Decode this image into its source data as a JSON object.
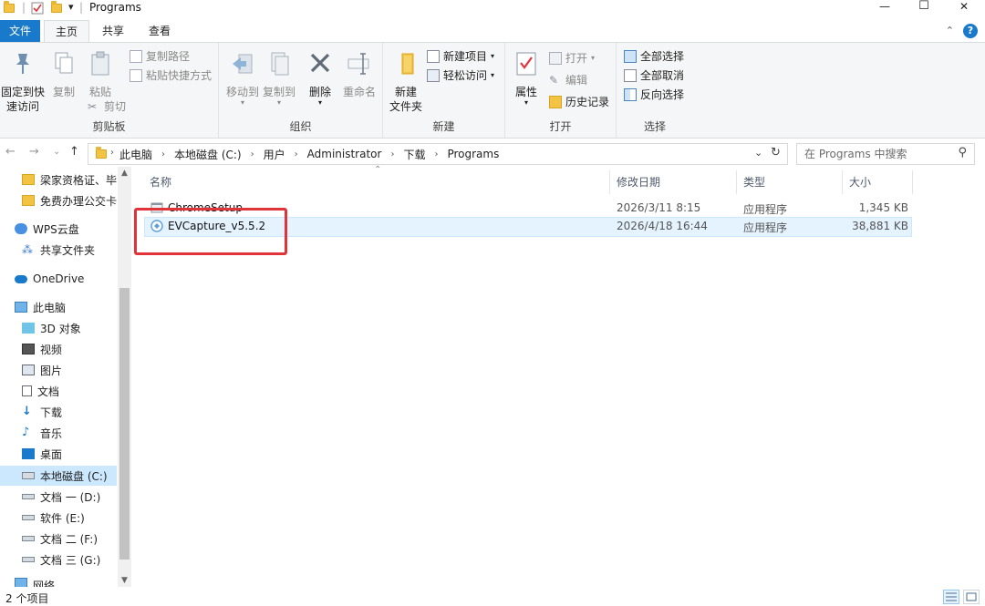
{
  "window": {
    "title": "Programs",
    "minimize_glyph": "—",
    "maximize_glyph": "☐",
    "close_glyph": "✕",
    "qa_dropdown_glyph": "▾",
    "qa_separator": "|"
  },
  "tabs": [
    {
      "label": "文件"
    },
    {
      "label": "主页"
    },
    {
      "label": "共享"
    },
    {
      "label": "查看"
    }
  ],
  "ribbon_right": {
    "collapse_glyph": "⌃",
    "help_glyph": "?"
  },
  "ribbon": {
    "clipboard": {
      "label": "剪贴板",
      "pin_line1": "固定到快",
      "pin_line2": "速访问",
      "copy": "复制",
      "paste": "粘贴",
      "copy_path": "复制路径",
      "paste_shortcut": "粘贴快捷方式",
      "cut": "剪切"
    },
    "organize": {
      "label": "组织",
      "move_to": "移动到",
      "copy_to": "复制到",
      "delete": "删除",
      "rename": "重命名"
    },
    "new": {
      "label": "新建",
      "new_folder_line1": "新建",
      "new_folder_line2": "文件夹",
      "new_item": "新建项目",
      "easy_access": "轻松访问"
    },
    "open": {
      "label": "打开",
      "properties": "属性",
      "open": "打开",
      "edit": "编辑",
      "history": "历史记录"
    },
    "select": {
      "label": "选择",
      "select_all": "全部选择",
      "select_none": "全部取消",
      "invert": "反向选择"
    }
  },
  "nav_glyphs": {
    "back": "←",
    "forward": "→",
    "recent": "⌄",
    "up": "↑",
    "refresh": "↻",
    "dropdown": "⌄",
    "search": "⚲",
    "sort": "⌃",
    "scroll_up": "▲",
    "scroll_down": "▼"
  },
  "address": {
    "breadcrumbs": [
      "此电脑",
      "本地磁盘 (C:)",
      "用户",
      "Administrator",
      "下载",
      "Programs"
    ],
    "separator": "›"
  },
  "search": {
    "placeholder": "在 Programs 中搜索"
  },
  "navpane": {
    "items": [
      {
        "label": "梁家资格证、毕",
        "icon": "folder-icon"
      },
      {
        "label": "免费办理公交卡",
        "icon": "folder-icon"
      },
      {
        "label": "WPS云盘",
        "icon": "cloud-icon"
      },
      {
        "label": "共享文件夹",
        "icon": "share-icon"
      },
      {
        "label": "OneDrive",
        "icon": "onedrive-icon"
      },
      {
        "label": "此电脑",
        "icon": "computer-icon"
      },
      {
        "label": "3D 对象",
        "icon": "cube-icon"
      },
      {
        "label": "视频",
        "icon": "video-icon"
      },
      {
        "label": "图片",
        "icon": "picture-icon"
      },
      {
        "label": "文档",
        "icon": "document-icon"
      },
      {
        "label": "下载",
        "icon": "download-icon"
      },
      {
        "label": "音乐",
        "icon": "music-icon"
      },
      {
        "label": "桌面",
        "icon": "desktop-icon"
      },
      {
        "label": "本地磁盘 (C:)",
        "icon": "drive-c-icon",
        "selected": true
      },
      {
        "label": "文档 一 (D:)",
        "icon": "drive-icon"
      },
      {
        "label": "软件 (E:)",
        "icon": "drive-icon"
      },
      {
        "label": "文档 二 (F:)",
        "icon": "drive-icon"
      },
      {
        "label": "文档 三 (G:)",
        "icon": "drive-icon"
      },
      {
        "label": "网络",
        "icon": "network-icon"
      }
    ]
  },
  "filelist": {
    "columns": [
      "名称",
      "修改日期",
      "类型",
      "大小"
    ],
    "rows": [
      {
        "name": "ChromeSetup",
        "modified": "2026/3/11 8:15",
        "type": "应用程序",
        "size": "1,345 KB"
      },
      {
        "name": "EVCapture_v5.5.2",
        "modified": "2026/4/18 16:44",
        "type": "应用程序",
        "size": "38,881 KB",
        "selected": true
      }
    ]
  },
  "status": {
    "count": "2 个项目"
  },
  "colors": {
    "accent": "#1979ca",
    "selection": "#cce8ff",
    "highlight_box": "#e0343a",
    "folder": "#f3c443"
  }
}
